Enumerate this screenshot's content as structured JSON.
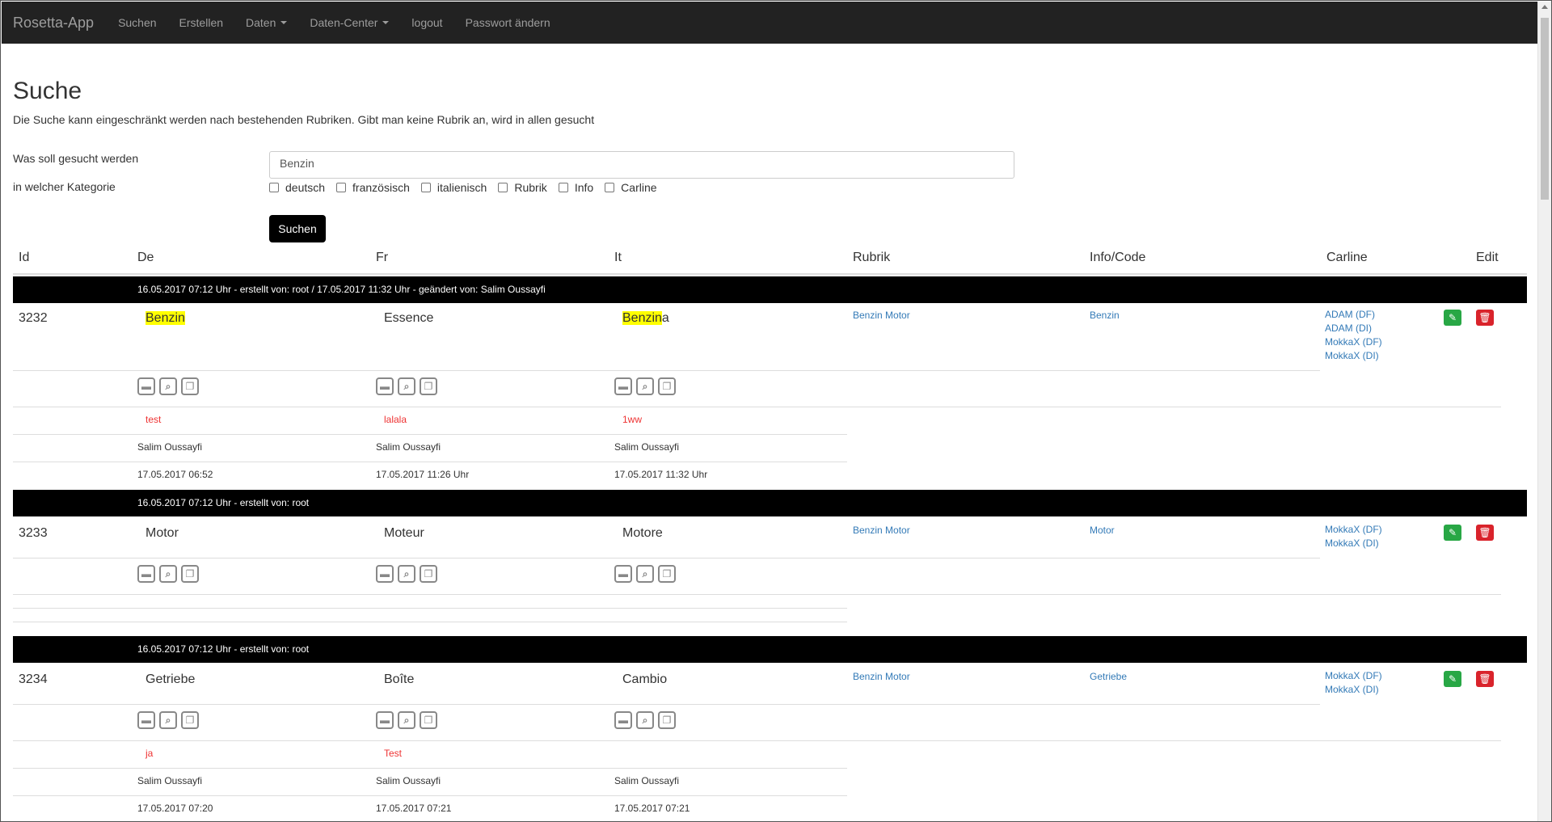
{
  "navbar": {
    "brand": "Rosetta-App",
    "items": [
      "Suchen",
      "Erstellen",
      "Daten",
      "Daten-Center",
      "logout",
      "Passwort ändern"
    ]
  },
  "page": {
    "title": "Suche",
    "subtitle": "Die Suche kann eingeschränkt werden nach bestehenden Rubriken. Gibt man keine Rubrik an, wird in allen gesucht",
    "label_search": "Was soll gesucht werden",
    "label_category": "in welcher Kategorie",
    "search_value": "Benzin",
    "categories": [
      "deutsch",
      "französisch",
      "italienisch",
      "Rubrik",
      "Info",
      "Carline"
    ],
    "search_button": "Suchen"
  },
  "table": {
    "headers": [
      "Id",
      "De",
      "Fr",
      "It",
      "Rubrik",
      "Info/Code",
      "Carline",
      "Edit"
    ]
  },
  "rows": [
    {
      "bar": "16.05.2017 07:12 Uhr - erstellt von: root / 17.05.2017 11:32 Uhr - geändert von: Salim Oussayfi",
      "id": "3232",
      "de_hl": "Benzin",
      "de_rest": "",
      "fr": "Essence",
      "it_hl": "Benzin",
      "it_rest": "a",
      "rubrik": "Benzin Motor",
      "info": "Benzin",
      "carline": [
        "ADAM (DF)",
        "ADAM (DI)",
        "MokkaX (DF)",
        "MokkaX (DI)"
      ],
      "comments": [
        "test",
        "lalala",
        "1ww"
      ],
      "authors": [
        "Salim Oussayfi",
        "Salim Oussayfi",
        "Salim Oussayfi"
      ],
      "dates": [
        "17.05.2017 06:52",
        "17.05.2017 11:26 Uhr",
        "17.05.2017 11:32 Uhr"
      ]
    },
    {
      "bar": "16.05.2017 07:12 Uhr - erstellt von: root",
      "id": "3233",
      "de": "Motor",
      "fr": "Moteur",
      "it": "Motore",
      "rubrik": "Benzin Motor",
      "info": "Motor",
      "carline": [
        "MokkaX (DF)",
        "MokkaX (DI)"
      ]
    },
    {
      "bar": "16.05.2017 07:12 Uhr - erstellt von: root",
      "id": "3234",
      "de": "Getriebe",
      "fr": "Boîte",
      "it": "Cambio",
      "rubrik": "Benzin Motor",
      "info": "Getriebe",
      "carline": [
        "MokkaX (DF)",
        "MokkaX (DI)"
      ],
      "comments": [
        "ja",
        "Test",
        ""
      ],
      "authors": [
        "Salim Oussayfi",
        "Salim Oussayfi",
        "Salim Oussayfi"
      ],
      "dates": [
        "17.05.2017 07:20",
        "17.05.2017 07:21",
        "17.05.2017 07:21"
      ]
    }
  ],
  "icons": {
    "comment": "comment-icon",
    "search": "search-icon",
    "copy": "copy-icon",
    "edit": "pencil-icon",
    "delete": "trash-icon"
  }
}
